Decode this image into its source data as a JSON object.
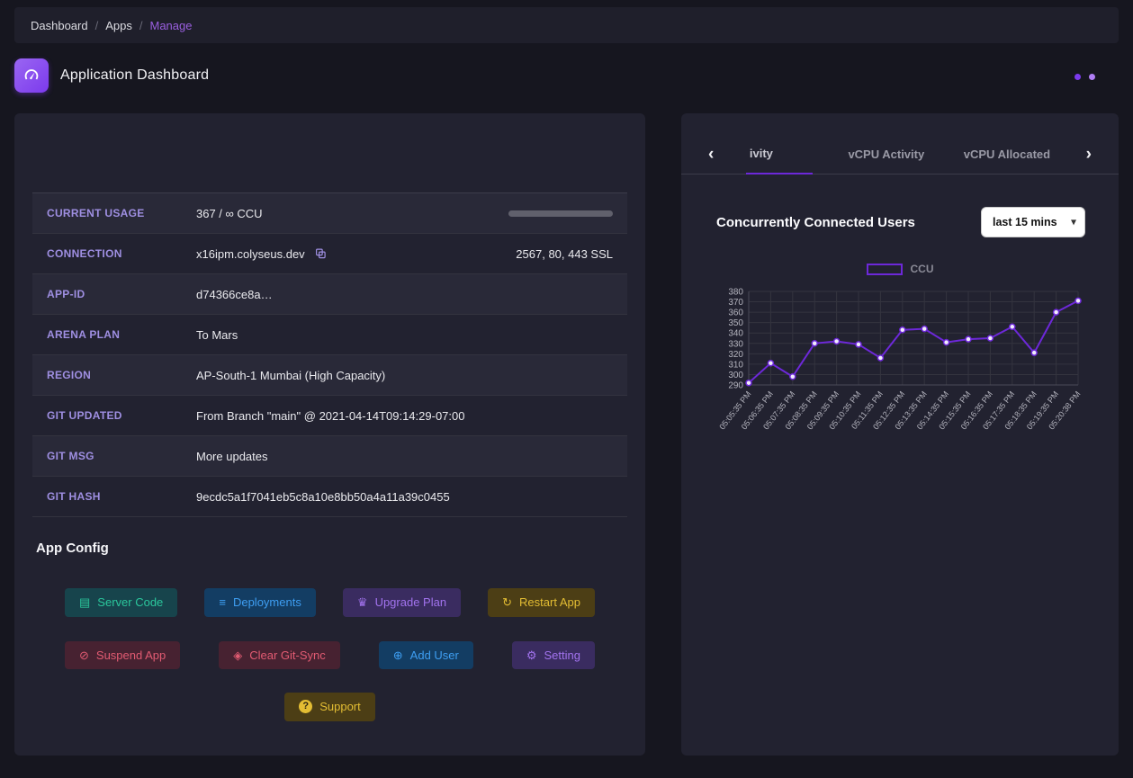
{
  "breadcrumb": {
    "separator": "/",
    "items": [
      {
        "label": "Dashboard"
      },
      {
        "label": "Apps"
      },
      {
        "label": "Manage"
      }
    ]
  },
  "header": {
    "title": "Application Dashboard"
  },
  "info_table": {
    "rows": [
      {
        "label": "CURRENT USAGE",
        "value": "367 / ∞ CCU"
      },
      {
        "label": "CONNECTION",
        "value": "x16ipm.colyseus.dev",
        "right": "2567, 80, 443 SSL"
      },
      {
        "label": "APP-ID",
        "value": "d74366ce8a…"
      },
      {
        "label": "ARENA PLAN",
        "value": "To Mars"
      },
      {
        "label": "REGION",
        "value": "AP-South-1 Mumbai (High Capacity)"
      },
      {
        "label": "GIT UPDATED",
        "value": "From Branch \"main\" @ 2021-04-14T09:14:29-07:00"
      },
      {
        "label": "GIT MSG",
        "value": "More updates"
      },
      {
        "label": "GIT HASH",
        "value": "9ecdc5a1f7041eb5c8a10e8bb50a4a11a39c0455"
      }
    ]
  },
  "app_config": {
    "title": "App Config",
    "buttons": [
      {
        "label": "Server Code",
        "glyph": "▤",
        "icon": "server-code-icon",
        "color": "teal"
      },
      {
        "label": "Deployments",
        "glyph": "≡",
        "icon": "deployments-icon",
        "color": "blue"
      },
      {
        "label": "Upgrade Plan",
        "glyph": "♛",
        "icon": "crown-icon",
        "color": "purple"
      },
      {
        "label": "Restart App",
        "glyph": "↻",
        "icon": "restart-icon",
        "color": "gold"
      },
      {
        "label": "Suspend App",
        "glyph": "⊘",
        "icon": "suspend-icon",
        "color": "red"
      },
      {
        "label": "Clear Git-Sync",
        "glyph": "◈",
        "icon": "git-sync-icon",
        "color": "red"
      },
      {
        "label": "Add User",
        "glyph": "⊕",
        "icon": "add-user-icon",
        "color": "blue"
      },
      {
        "label": "Setting",
        "glyph": "⚙",
        "icon": "gear-icon",
        "color": "purple"
      },
      {
        "label": "Support",
        "glyph": "?",
        "icon": "help-icon",
        "color": "gold"
      }
    ]
  },
  "activity_panel": {
    "prev_arrow": "‹",
    "next_arrow": "›",
    "tabs": [
      {
        "label": "ivity",
        "active": true
      },
      {
        "label": "vCPU Activity",
        "active": false
      },
      {
        "label": "vCPU Allocated",
        "active": false
      }
    ],
    "title": "Concurrently Connected Users",
    "range_options": [
      "last 15 mins"
    ],
    "range_selected": "last 15 mins"
  },
  "chart_data": {
    "type": "line",
    "title": "Concurrently Connected Users",
    "legend_position": "top",
    "grid": true,
    "ylim": [
      290,
      380
    ],
    "ytick_step": 10,
    "x": [
      "05:05:35 PM",
      "05:06:35 PM",
      "05:07:35 PM",
      "05:08:35 PM",
      "05:09:35 PM",
      "05:10:35 PM",
      "05:11:35 PM",
      "05:12:35 PM",
      "05:13:35 PM",
      "05:14:35 PM",
      "05:15:35 PM",
      "05:16:35 PM",
      "05:17:35 PM",
      "05:18:35 PM",
      "05:19:35 PM",
      "05:20:38 PM"
    ],
    "series": [
      {
        "name": "CCU",
        "values": [
          292,
          311,
          298,
          330,
          332,
          329,
          316,
          343,
          344,
          331,
          334,
          335,
          346,
          321,
          360,
          371
        ]
      }
    ],
    "colors": {
      "line": "#6d28d9",
      "marker_fill": "#f1ecfb",
      "grid": "#34343f",
      "axis": "#4a4a58",
      "tick_text": "#b4b4be"
    }
  },
  "colors": {
    "page_bg": "#16161f",
    "card_bg": "#222230",
    "accent_purple": "#7c3aed",
    "label_purple": "#9f8fe2"
  }
}
